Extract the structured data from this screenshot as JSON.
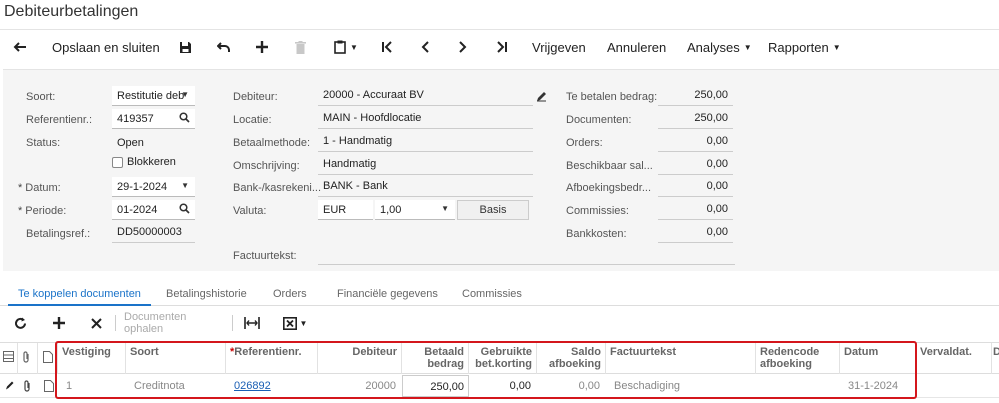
{
  "page": {
    "title": "Debiteurbetalingen"
  },
  "toolbar": {
    "back_icon": "arrow-left-icon",
    "save_close": "Opslaan en sluiten",
    "save_icon": "floppy-disk-icon",
    "undo_icon": "undo-icon",
    "add_icon": "plus-icon",
    "delete_icon": "trash-icon",
    "clipboard_icon": "clipboard-icon",
    "first_icon": "first-page-icon",
    "prev_icon": "chevron-left-icon",
    "next_icon": "chevron-right-icon",
    "last_icon": "last-page-icon",
    "release": "Vrijgeven",
    "cancel": "Annuleren",
    "analyses": "Analyses",
    "reports": "Rapporten"
  },
  "form": {
    "left": {
      "type_label": "Soort:",
      "type_value": "Restitutie deb",
      "ref_label": "Referentienr.:",
      "ref_value": "419357",
      "status_label": "Status:",
      "status_value": "Open",
      "block_label": "Blokkeren",
      "block_checked": false,
      "date_label": "Datum:",
      "date_value": "29-1-2024",
      "period_label": "Periode:",
      "period_value": "01-2024",
      "payref_label": "Betalingsref.:",
      "payref_value": "DD50000003"
    },
    "middle": {
      "customer_label": "Debiteur:",
      "customer_value": "20000 - Accuraat BV",
      "location_label": "Locatie:",
      "location_value": "MAIN - Hoofdlocatie",
      "method_label": "Betaalmethode:",
      "method_value": "1 - Handmatig",
      "desc_label": "Omschrijving:",
      "desc_value": "Handmatig",
      "cash_label": "Bank-/kasrekeni...",
      "cash_value": "BANK - Bank",
      "currency_label": "Valuta:",
      "currency_value": "EUR",
      "rate_value": "1,00",
      "basis_label": "Basis",
      "invoice_text_label": "Factuurtekst:",
      "invoice_text_value": ""
    },
    "right": {
      "amount_label": "Te betalen bedrag:",
      "amount_value": "250,00",
      "documents_label": "Documenten:",
      "documents_value": "250,00",
      "orders_label": "Orders:",
      "orders_value": "0,00",
      "available_label": "Beschikbaar sal...",
      "available_value": "0,00",
      "writeoff_label": "Afboekingsbedr...",
      "writeoff_value": "0,00",
      "commissions_label": "Commissies:",
      "commissions_value": "0,00",
      "bankcosts_label": "Bankkosten:",
      "bankcosts_value": "0,00"
    }
  },
  "tabs": [
    "Te koppelen documenten",
    "Betalingshistorie",
    "Orders",
    "Financiële gegevens",
    "Commissies"
  ],
  "grid_toolbar": {
    "refresh_icon": "refresh-icon",
    "add_icon": "plus-icon",
    "remove_icon": "x-icon",
    "load_docs": "Documenten ophalen",
    "fit_icon": "fit-columns-icon",
    "excel_icon": "excel-export-icon"
  },
  "grid": {
    "headers": {
      "branch": "Vestiging",
      "type": "Soort",
      "ref": "Referentienr.",
      "customer": "Debiteur",
      "paid_1": "Betaald",
      "paid_2": "bedrag",
      "disc_1": "Gebruikte",
      "disc_2": "bet.korting",
      "bal_1": "Saldo",
      "bal_2": "afboeking",
      "invtext": "Factuurtekst",
      "reason_1": "Redencode",
      "reason_2": "afboeking",
      "date": "Datum",
      "due": "Vervaldat.",
      "cut": "D"
    },
    "rows": [
      {
        "branch": "1",
        "type": "Creditnota",
        "ref": "026892",
        "customer": "20000",
        "paid": "250,00",
        "discount": "0,00",
        "balance": "0,00",
        "invtext": "Beschadiging",
        "reason": "",
        "date": "31-1-2024",
        "due": ""
      }
    ]
  },
  "colors": {
    "accent": "#1a73c9",
    "highlight": "#d4161c",
    "link": "#1a5fb4"
  }
}
